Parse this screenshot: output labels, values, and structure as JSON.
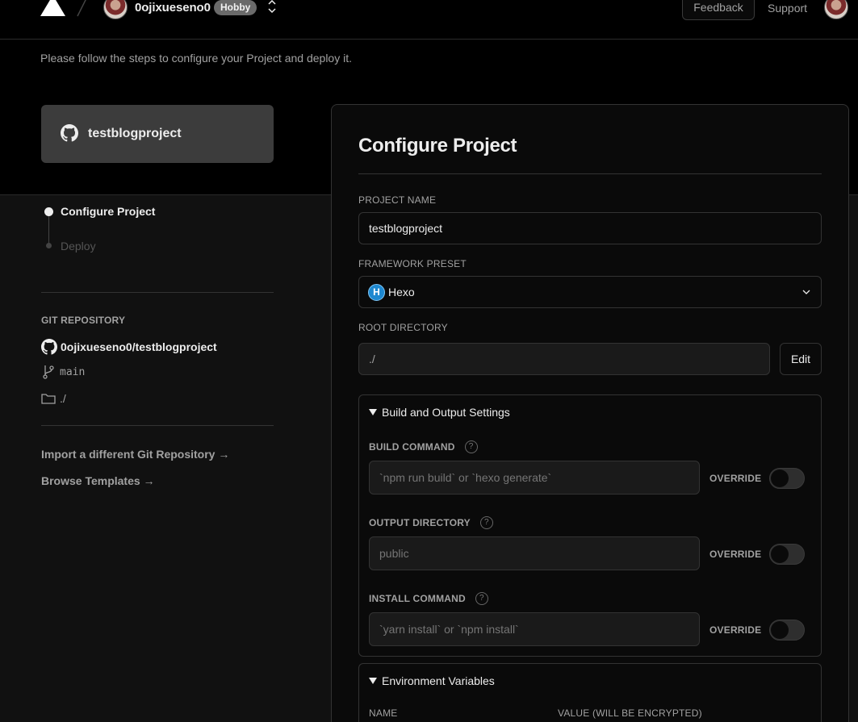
{
  "header": {
    "team_name": "0ojixueseno0",
    "plan_badge": "Hobby",
    "feedback_label": "Feedback",
    "support_label": "Support"
  },
  "subtitle": "Please follow the steps to configure your Project and deploy it.",
  "repo_card": {
    "name": "testblogproject"
  },
  "steps": [
    {
      "label": "Configure Project",
      "active": true
    },
    {
      "label": "Deploy",
      "active": false
    }
  ],
  "git": {
    "heading": "GIT REPOSITORY",
    "repo": "0ojixueseno0/testblogproject",
    "branch": "main",
    "directory": "./"
  },
  "links": {
    "import": "Import a different Git Repository →",
    "templates": "Browse Templates →"
  },
  "config": {
    "title": "Configure Project",
    "project_name_label": "PROJECT NAME",
    "project_name_value": "testblogproject",
    "framework_label": "FRAMEWORK PRESET",
    "framework_value": "Hexo",
    "framework_icon_letter": "H",
    "root_label": "ROOT DIRECTORY",
    "root_value": "./",
    "edit_label": "Edit",
    "build_section": "Build and Output Settings",
    "build_command_label": "BUILD COMMAND",
    "build_command_placeholder": "`npm run build` or `hexo generate`",
    "output_dir_label": "OUTPUT DIRECTORY",
    "output_dir_placeholder": "public",
    "install_command_label": "INSTALL COMMAND",
    "install_command_placeholder": "`yarn install` or `npm install`",
    "override_label": "OVERRIDE",
    "help_glyph": "?",
    "env_section": "Environment Variables",
    "env_name_col": "NAME",
    "env_value_col": "VALUE (WILL BE ENCRYPTED)"
  },
  "toggles": {
    "build_override": false,
    "output_override": false,
    "install_override": false
  },
  "colors": {
    "background": "#000000",
    "surface": "#0a0a0a",
    "border": "#333333",
    "muted_text": "#a1a1a1",
    "framework_icon": "#1e88d0"
  }
}
